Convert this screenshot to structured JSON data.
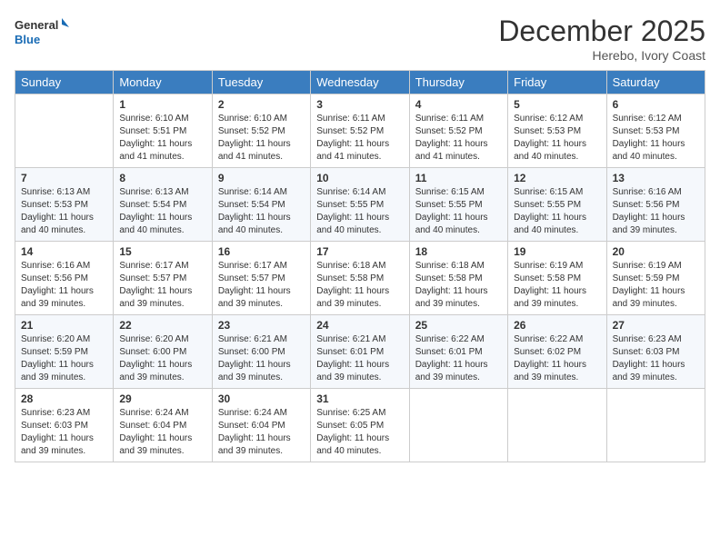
{
  "header": {
    "logo_general": "General",
    "logo_blue": "Blue",
    "month_title": "December 2025",
    "location": "Herebo, Ivory Coast"
  },
  "days_of_week": [
    "Sunday",
    "Monday",
    "Tuesday",
    "Wednesday",
    "Thursday",
    "Friday",
    "Saturday"
  ],
  "weeks": [
    [
      {
        "day": "",
        "sunrise": "",
        "sunset": "",
        "daylight": ""
      },
      {
        "day": "1",
        "sunrise": "6:10 AM",
        "sunset": "5:51 PM",
        "daylight": "11 hours and 41 minutes."
      },
      {
        "day": "2",
        "sunrise": "6:10 AM",
        "sunset": "5:52 PM",
        "daylight": "11 hours and 41 minutes."
      },
      {
        "day": "3",
        "sunrise": "6:11 AM",
        "sunset": "5:52 PM",
        "daylight": "11 hours and 41 minutes."
      },
      {
        "day": "4",
        "sunrise": "6:11 AM",
        "sunset": "5:52 PM",
        "daylight": "11 hours and 41 minutes."
      },
      {
        "day": "5",
        "sunrise": "6:12 AM",
        "sunset": "5:53 PM",
        "daylight": "11 hours and 40 minutes."
      },
      {
        "day": "6",
        "sunrise": "6:12 AM",
        "sunset": "5:53 PM",
        "daylight": "11 hours and 40 minutes."
      }
    ],
    [
      {
        "day": "7",
        "sunrise": "6:13 AM",
        "sunset": "5:53 PM",
        "daylight": "11 hours and 40 minutes."
      },
      {
        "day": "8",
        "sunrise": "6:13 AM",
        "sunset": "5:54 PM",
        "daylight": "11 hours and 40 minutes."
      },
      {
        "day": "9",
        "sunrise": "6:14 AM",
        "sunset": "5:54 PM",
        "daylight": "11 hours and 40 minutes."
      },
      {
        "day": "10",
        "sunrise": "6:14 AM",
        "sunset": "5:55 PM",
        "daylight": "11 hours and 40 minutes."
      },
      {
        "day": "11",
        "sunrise": "6:15 AM",
        "sunset": "5:55 PM",
        "daylight": "11 hours and 40 minutes."
      },
      {
        "day": "12",
        "sunrise": "6:15 AM",
        "sunset": "5:55 PM",
        "daylight": "11 hours and 40 minutes."
      },
      {
        "day": "13",
        "sunrise": "6:16 AM",
        "sunset": "5:56 PM",
        "daylight": "11 hours and 39 minutes."
      }
    ],
    [
      {
        "day": "14",
        "sunrise": "6:16 AM",
        "sunset": "5:56 PM",
        "daylight": "11 hours and 39 minutes."
      },
      {
        "day": "15",
        "sunrise": "6:17 AM",
        "sunset": "5:57 PM",
        "daylight": "11 hours and 39 minutes."
      },
      {
        "day": "16",
        "sunrise": "6:17 AM",
        "sunset": "5:57 PM",
        "daylight": "11 hours and 39 minutes."
      },
      {
        "day": "17",
        "sunrise": "6:18 AM",
        "sunset": "5:58 PM",
        "daylight": "11 hours and 39 minutes."
      },
      {
        "day": "18",
        "sunrise": "6:18 AM",
        "sunset": "5:58 PM",
        "daylight": "11 hours and 39 minutes."
      },
      {
        "day": "19",
        "sunrise": "6:19 AM",
        "sunset": "5:58 PM",
        "daylight": "11 hours and 39 minutes."
      },
      {
        "day": "20",
        "sunrise": "6:19 AM",
        "sunset": "5:59 PM",
        "daylight": "11 hours and 39 minutes."
      }
    ],
    [
      {
        "day": "21",
        "sunrise": "6:20 AM",
        "sunset": "5:59 PM",
        "daylight": "11 hours and 39 minutes."
      },
      {
        "day": "22",
        "sunrise": "6:20 AM",
        "sunset": "6:00 PM",
        "daylight": "11 hours and 39 minutes."
      },
      {
        "day": "23",
        "sunrise": "6:21 AM",
        "sunset": "6:00 PM",
        "daylight": "11 hours and 39 minutes."
      },
      {
        "day": "24",
        "sunrise": "6:21 AM",
        "sunset": "6:01 PM",
        "daylight": "11 hours and 39 minutes."
      },
      {
        "day": "25",
        "sunrise": "6:22 AM",
        "sunset": "6:01 PM",
        "daylight": "11 hours and 39 minutes."
      },
      {
        "day": "26",
        "sunrise": "6:22 AM",
        "sunset": "6:02 PM",
        "daylight": "11 hours and 39 minutes."
      },
      {
        "day": "27",
        "sunrise": "6:23 AM",
        "sunset": "6:03 PM",
        "daylight": "11 hours and 39 minutes."
      }
    ],
    [
      {
        "day": "28",
        "sunrise": "6:23 AM",
        "sunset": "6:03 PM",
        "daylight": "11 hours and 39 minutes."
      },
      {
        "day": "29",
        "sunrise": "6:24 AM",
        "sunset": "6:04 PM",
        "daylight": "11 hours and 39 minutes."
      },
      {
        "day": "30",
        "sunrise": "6:24 AM",
        "sunset": "6:04 PM",
        "daylight": "11 hours and 39 minutes."
      },
      {
        "day": "31",
        "sunrise": "6:25 AM",
        "sunset": "6:05 PM",
        "daylight": "11 hours and 40 minutes."
      },
      {
        "day": "",
        "sunrise": "",
        "sunset": "",
        "daylight": ""
      },
      {
        "day": "",
        "sunrise": "",
        "sunset": "",
        "daylight": ""
      },
      {
        "day": "",
        "sunrise": "",
        "sunset": "",
        "daylight": ""
      }
    ]
  ],
  "labels": {
    "sunrise_prefix": "Sunrise: ",
    "sunset_prefix": "Sunset: ",
    "daylight_prefix": "Daylight: "
  }
}
